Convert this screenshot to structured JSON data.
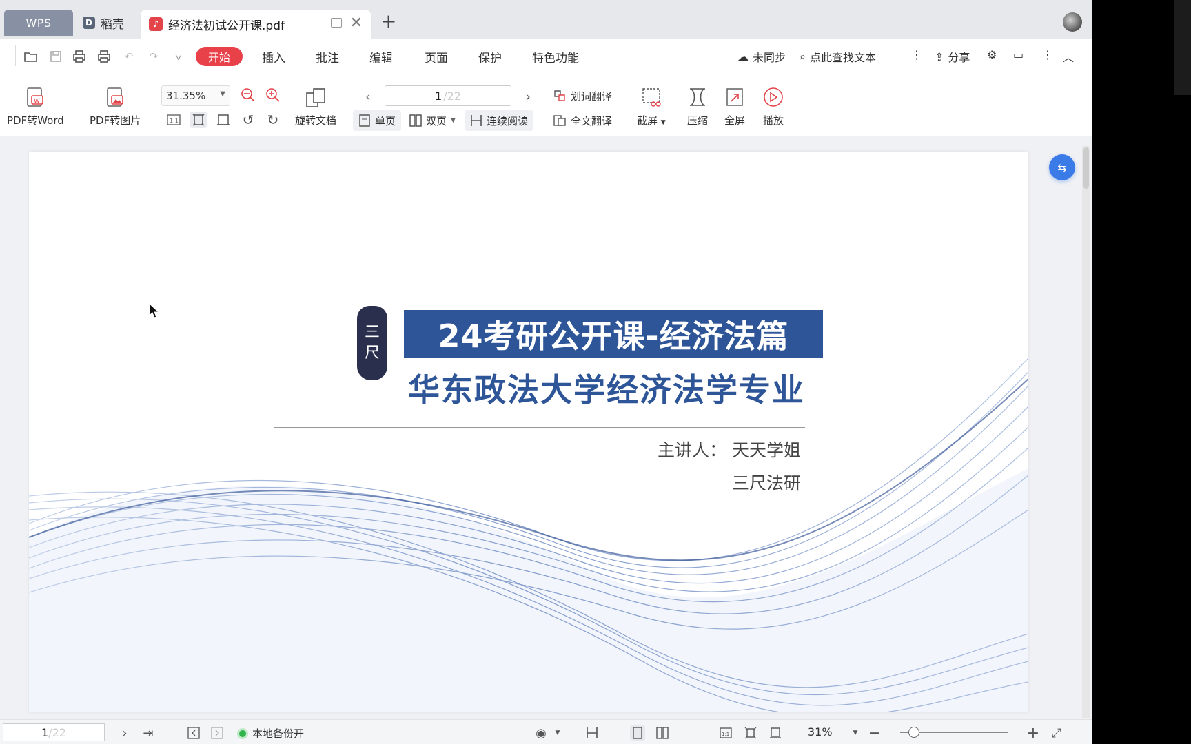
{
  "tabs": {
    "wps": "WPS",
    "daoke": "稻壳",
    "daoke_icon": "D",
    "document": "经济法初试公开课.pdf"
  },
  "menu": {
    "items": [
      "开始",
      "插入",
      "批注",
      "编辑",
      "页面",
      "保护",
      "特色功能"
    ],
    "active": "开始",
    "sync": "未同步",
    "search": "点此查找文本",
    "share": "分享"
  },
  "ribbon": {
    "pdf_to_word": "PDF转Word",
    "pdf_to_image": "PDF转图片",
    "zoom_value": "31.35%",
    "rotate_doc": "旋转文档",
    "page_current": "1",
    "page_total": "/22",
    "single_page": "单页",
    "double_page": "双页",
    "continuous": "连续阅读",
    "word_translate": "划词翻译",
    "full_translate": "全文翻译",
    "screenshot": "截屏",
    "compress": "压缩",
    "fullscreen": "全屏",
    "play": "播放"
  },
  "slide": {
    "title": "24考研公开课-经济法篇",
    "seal_chars": [
      "三",
      "尺"
    ],
    "subtitle": "华东政法大学经济法学专业",
    "lecturer": "主讲人：  天天学姐",
    "organization": "三尺法研",
    "accent_color": "#2e5597"
  },
  "statusbar": {
    "page_current": "1",
    "page_total": "/22",
    "backup": "本地备份开",
    "zoom": "31%"
  },
  "colors": {
    "active_menu": "#e8414a",
    "float_button": "#3b7be8",
    "backup_dot": "#2fb34a"
  }
}
